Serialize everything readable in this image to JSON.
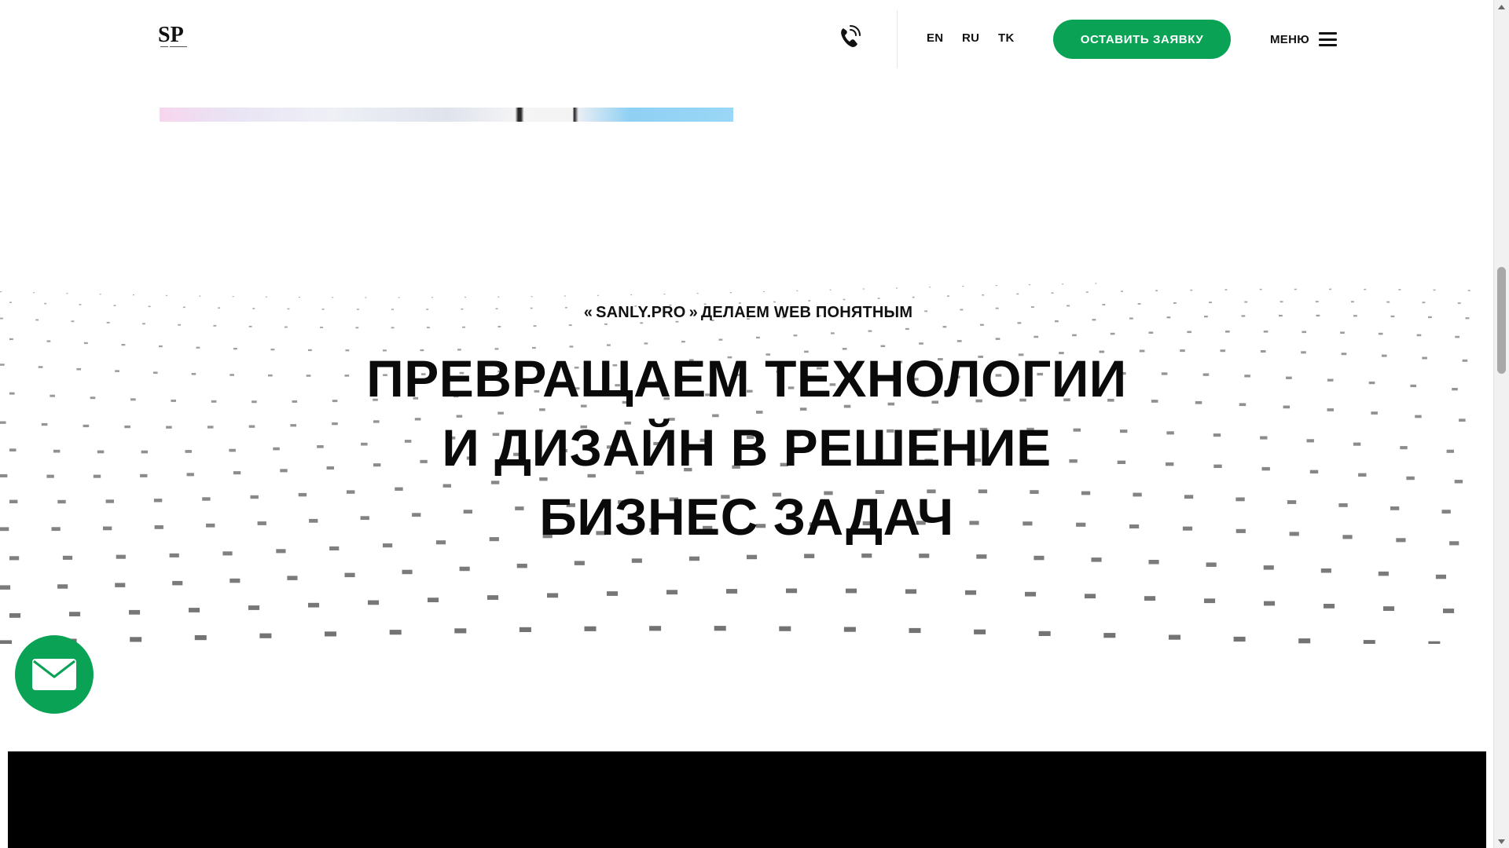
{
  "header": {
    "logo_text": "SP",
    "languages": [
      "EN",
      "RU",
      "TK"
    ],
    "cta_label": "ОСТАВИТЬ ЗАЯВКУ",
    "menu_label": "МЕНЮ"
  },
  "hero": {
    "kicker_brand": "SANLY.PRO",
    "kicker_text": "ДЕЛАЕМ WEB ПОНЯТНЫМ",
    "title_lines": [
      "ПРЕВРАЩАЕМ ТЕХНОЛОГИИ",
      "И ДИЗАЙН В РЕШЕНИЕ",
      "БИЗНЕС ЗАДАЧ"
    ]
  },
  "icons": {
    "phone": "phone-icon",
    "mail": "mail-icon",
    "menu": "hamburger-icon",
    "scroll_up": "scroll-up-arrow-icon",
    "scroll_down": "scroll-down-arrow-icon"
  },
  "colors": {
    "accent": "#0aa356",
    "text": "#0a0a0a",
    "dark_block": "#000000",
    "dot": "#6b6b6b"
  }
}
